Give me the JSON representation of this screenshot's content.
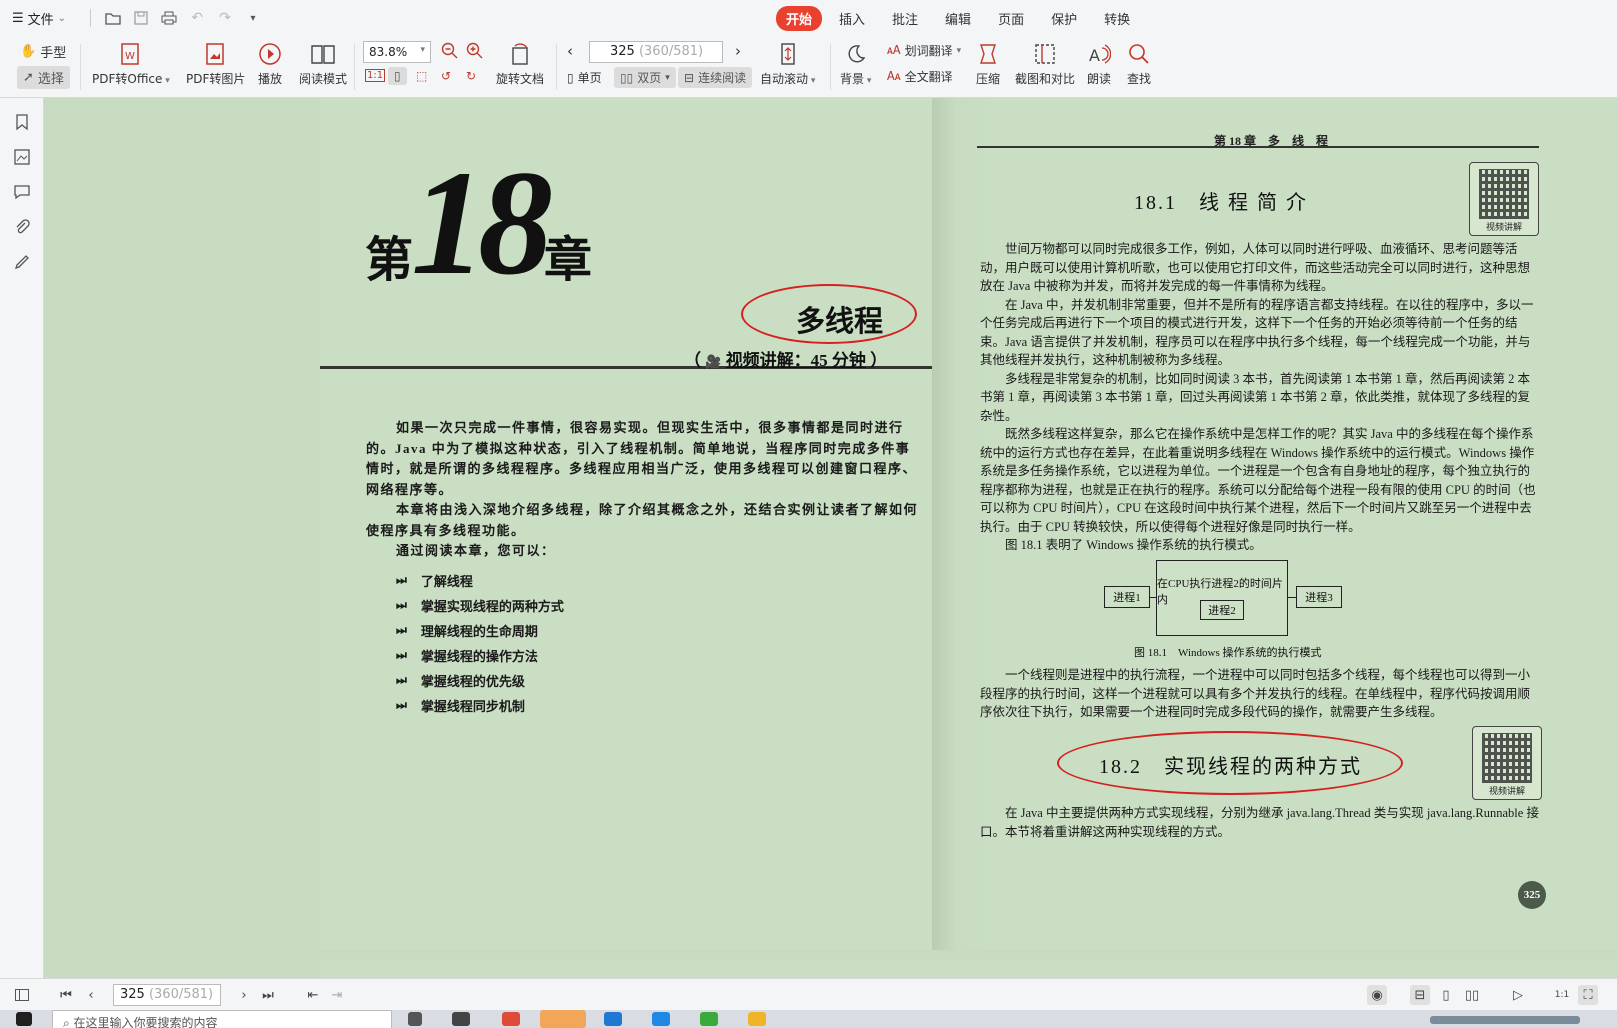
{
  "menu": {
    "file_label": "文件",
    "tabs": [
      {
        "label": "开始",
        "active": true
      },
      {
        "label": "插入"
      },
      {
        "label": "批注"
      },
      {
        "label": "编辑"
      },
      {
        "label": "页面"
      },
      {
        "label": "保护"
      },
      {
        "label": "转换"
      }
    ]
  },
  "toolbar": {
    "hand_label": "手型",
    "select_label": "选择",
    "pdf_to_office": "PDF转Office",
    "pdf_to_image": "PDF转图片",
    "play": "播放",
    "read_mode": "阅读模式",
    "zoom": "83.8%",
    "rotate": "旋转文档",
    "page_current": "325",
    "page_total": "(360/581)",
    "single_page": "单页",
    "double_page": "双页",
    "continuous": "连续阅读",
    "auto_scroll": "自动滚动",
    "background": "背景",
    "word_translate": "划词翻译",
    "full_translate": "全文翻译",
    "compress": "压缩",
    "screenshot_compare": "截图和对比",
    "read_aloud": "朗读",
    "find": "查找"
  },
  "left_page": {
    "chapter_prefix": "第",
    "chapter_number": "18",
    "chapter_suffix": "章",
    "title": "多线程",
    "video_open": "（",
    "video_text": "视频讲解：45 分钟",
    "video_close": "）",
    "intro": [
      "如果一次只完成一件事情，很容易实现。但现实生活中，很多事情都是同时进行的。Java 中为了模拟这种状态，引入了线程机制。简单地说，当程序同时完成多件事情时，就是所谓的多线程程序。多线程应用相当广泛，使用多线程可以创建窗口程序、网络程序等。",
      "本章将由浅入深地介绍多线程，除了介绍其概念之外，还结合实例让读者了解如何使程序具有多线程功能。",
      "通过阅读本章，您可以："
    ],
    "goals": [
      "了解线程",
      "掌握实现线程的两种方式",
      "理解线程的生命周期",
      "掌握线程的操作方法",
      "掌握线程的优先级",
      "掌握线程同步机制"
    ]
  },
  "right_page": {
    "running_head": "第 18 章　多　线　程",
    "qr_caption": "视频讲解",
    "sec1_title": "18.1　线 程 简 介",
    "sec1_paragraphs": [
      "世间万物都可以同时完成很多工作，例如，人体可以同时进行呼吸、血液循环、思考问题等活动，用户既可以使用计算机听歌，也可以使用它打印文件，而这些活动完全可以同时进行，这种思想放在 Java 中被称为并发，而将并发完成的每一件事情称为线程。",
      "在 Java 中，并发机制非常重要，但并不是所有的程序语言都支持线程。在以往的程序中，多以一个任务完成后再进行下一个项目的模式进行开发，这样下一个任务的开始必须等待前一个任务的结束。Java 语言提供了并发机制，程序员可以在程序中执行多个线程，每一个线程完成一个功能，并与其他线程并发执行，这种机制被称为多线程。",
      "多线程是非常复杂的机制，比如同时阅读 3 本书，首先阅读第 1 本书第 1 章，然后再阅读第 2 本书第 1 章，再阅读第 3 本书第 1 章，回过头再阅读第 1 本书第 2 章，依此类推，就体现了多线程的复杂性。",
      "既然多线程这样复杂，那么它在操作系统中是怎样工作的呢？其实 Java 中的多线程在每个操作系统中的运行方式也存在差异，在此着重说明多线程在 Windows 操作系统中的运行模式。Windows 操作系统是多任务操作系统，它以进程为单位。一个进程是一个包含有自身地址的程序，每个独立执行的程序都称为进程，也就是正在执行的程序。系统可以分配给每个进程一段有限的使用 CPU 的时间（也可以称为 CPU 时间片），CPU 在这段时间中执行某个进程，然后下一个时间片又跳至另一个进程中去执行。由于 CPU 转换较快，所以使得每个进程好像是同时执行一样。",
      "图 18.1 表明了 Windows 操作系统的执行模式。"
    ],
    "figure": {
      "process1": "进程1",
      "cpu_label": "在CPU执行进程2的时间片内",
      "process2": "进程2",
      "process3": "进程3",
      "caption": "图 18.1　Windows 操作系统的执行模式"
    },
    "sec1_after": "一个线程则是进程中的执行流程，一个进程中可以同时包括多个线程，每个线程也可以得到一小段程序的执行时间，这样一个进程就可以具有多个并发执行的线程。在单线程中，程序代码按调用顺序依次往下执行，如果需要一个进程同时完成多段代码的操作，就需要产生多线程。",
    "sec2_title": "18.2　实现线程的两种方式",
    "sec2_text": "在 Java 中主要提供两种方式实现线程，分别为继承 java.lang.Thread 类与实现 java.lang.Runnable 接口。本节将着重讲解这两种实现线程的方式。",
    "page_number": "325"
  },
  "statusbar": {
    "page_current": "325",
    "page_total": "(360/581)"
  },
  "taskbar": {
    "search_placeholder": "在这里输入你要搜索的内容"
  },
  "colors": {
    "accent": "#e8412f",
    "annotation_ellipse": "#d62020",
    "reading_background": "#c6dbbf"
  }
}
